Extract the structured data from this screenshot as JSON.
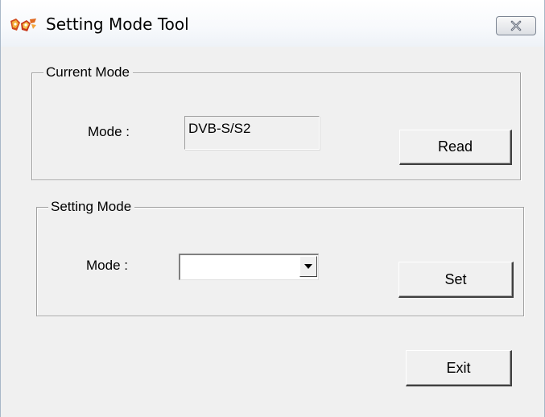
{
  "window": {
    "title": "Setting Mode Tool",
    "app_icon": "app-logo-icon",
    "close_icon": "close-icon"
  },
  "current_mode": {
    "group_label": "Current Mode",
    "field_label": "Mode :",
    "value": "DVB-S/S2",
    "read_button": "Read"
  },
  "setting_mode": {
    "group_label": "Setting Mode",
    "field_label": "Mode :",
    "selected_value": "",
    "dropdown_icon": "chevron-down-icon",
    "set_button": "Set"
  },
  "footer": {
    "exit_button": "Exit"
  },
  "colors": {
    "face": "#f0f0f0",
    "shadow": "#a0a0a0",
    "dark_shadow": "#404040",
    "highlight": "#ffffff"
  }
}
